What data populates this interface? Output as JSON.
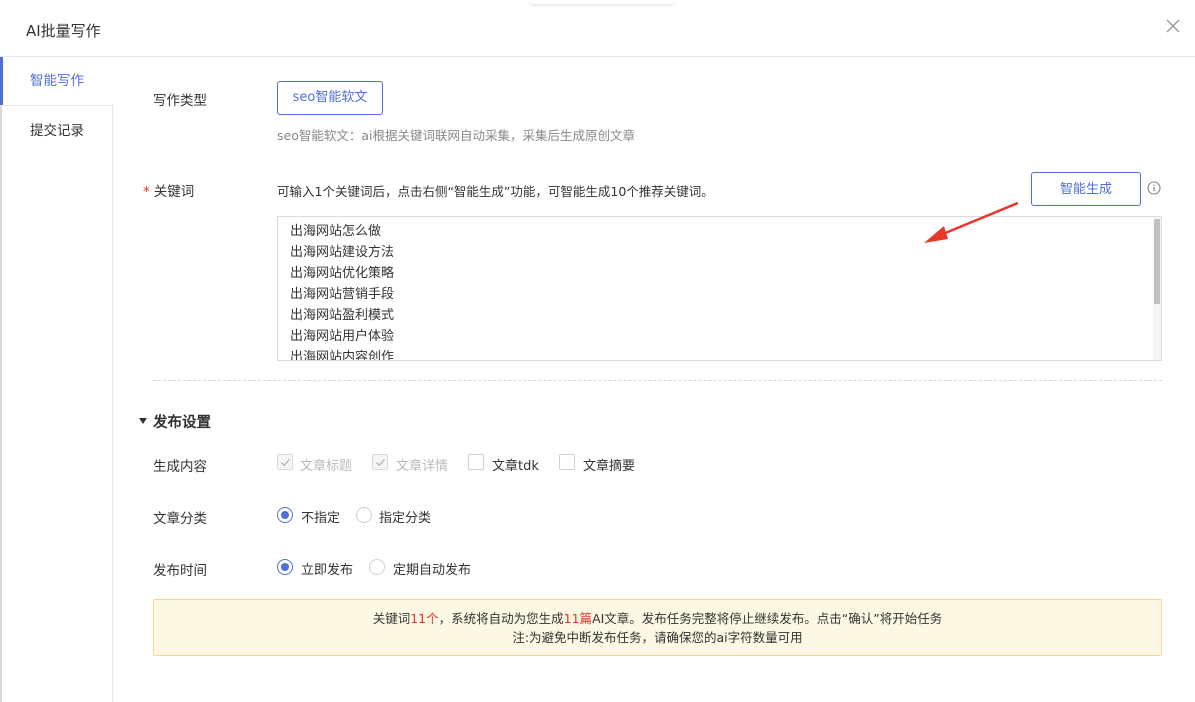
{
  "dialog": {
    "title": "AI批量写作"
  },
  "sidebar": {
    "items": [
      {
        "label": "智能写作",
        "active": true
      },
      {
        "label": "提交记录",
        "active": false
      }
    ]
  },
  "form": {
    "writing_type": {
      "label": "写作类型",
      "button": "seo智能软文",
      "hint": "seo智能软文：ai根据关键词联网自动采集，采集后生成原创文章"
    },
    "keywords": {
      "required_mark": "*",
      "label": "关键词",
      "hint": "可输入1个关键词后，点击右侧“智能生成”功能，可智能生成10个推荐关键词。",
      "generate_button": "智能生成",
      "lines": [
        "出海网站怎么做",
        "出海网站建设方法",
        "出海网站优化策略",
        "出海网站营销手段",
        "出海网站盈利模式",
        "出海网站用户体验",
        "出海网站内容创作"
      ]
    }
  },
  "publish": {
    "section_title": "发布设置",
    "content": {
      "label": "生成内容",
      "options": [
        {
          "label": "文章标题",
          "checked": true,
          "disabled": true
        },
        {
          "label": "文章详情",
          "checked": true,
          "disabled": true
        },
        {
          "label": "文章tdk",
          "checked": false,
          "disabled": false
        },
        {
          "label": "文章摘要",
          "checked": false,
          "disabled": false
        }
      ]
    },
    "category": {
      "label": "文章分类",
      "options": [
        {
          "label": "不指定",
          "selected": true
        },
        {
          "label": "指定分类",
          "selected": false
        }
      ]
    },
    "time": {
      "label": "发布时间",
      "options": [
        {
          "label": "立即发布",
          "selected": true
        },
        {
          "label": "定期自动发布",
          "selected": false
        }
      ]
    }
  },
  "notice": {
    "p1": "关键词",
    "kw_count": "11个",
    "p2": "，系统将自动为您生成",
    "article_count": "11篇",
    "p3": "AI文章。发布任务完整将停止继续发布。点击“确认”将开始任务",
    "line2": "注:为避免中断发布任务，请确保您的ai字符数量可用"
  },
  "colors": {
    "accent": "#4f6fd6",
    "required": "#e0352b",
    "notice_bg": "#fdf8e3",
    "arrow": "#e8382c"
  }
}
